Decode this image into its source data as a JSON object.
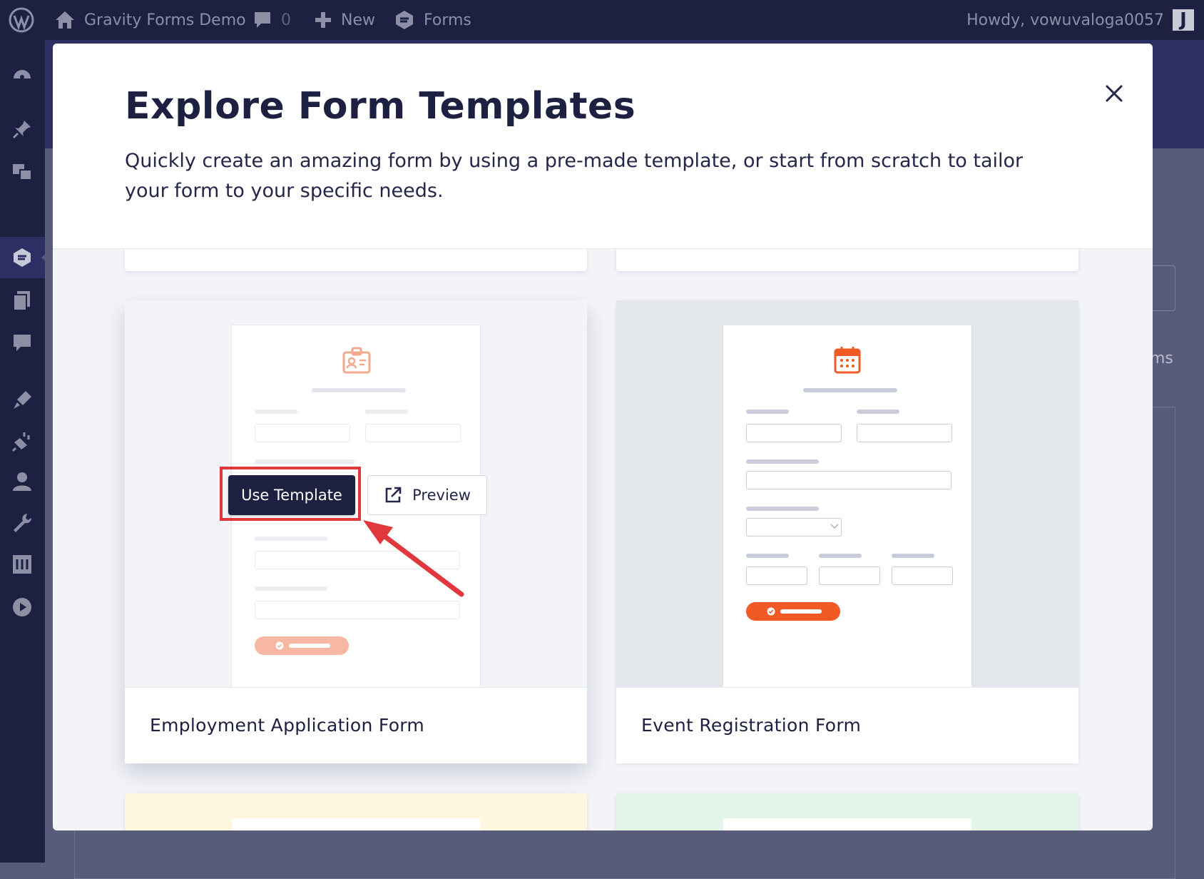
{
  "admin_bar": {
    "site_name": "Gravity Forms Demo",
    "comments_count": "0",
    "new_label": "New",
    "forms_label": "Forms",
    "greeting": "Howdy, vowuvaloga0057",
    "avatar_letter": "J"
  },
  "background": {
    "partial_text": "ms"
  },
  "modal": {
    "title": "Explore Form Templates",
    "description": "Quickly create an amazing form by using a pre-made template, or start from scratch to tailor your form to your specific needs.",
    "close_icon": "close-icon"
  },
  "templates": [
    {
      "name": "Employment Application Form",
      "icon": "id-badge-icon",
      "theme": {
        "thumb_bg": "#f4f4f8",
        "accent": "#f3a98e",
        "bars": "#eceef3"
      },
      "use_label": "Use Template",
      "preview_label": "Preview"
    },
    {
      "name": "Event Registration Form",
      "icon": "calendar-icon",
      "theme": {
        "thumb_bg": "#e3e7eb",
        "accent": "#f15a24",
        "bars": "#c9ccdb"
      }
    }
  ],
  "colors": {
    "admin_bar": "#1d2040",
    "highlight": "#e0383d",
    "primary_button": "#1d2040"
  }
}
